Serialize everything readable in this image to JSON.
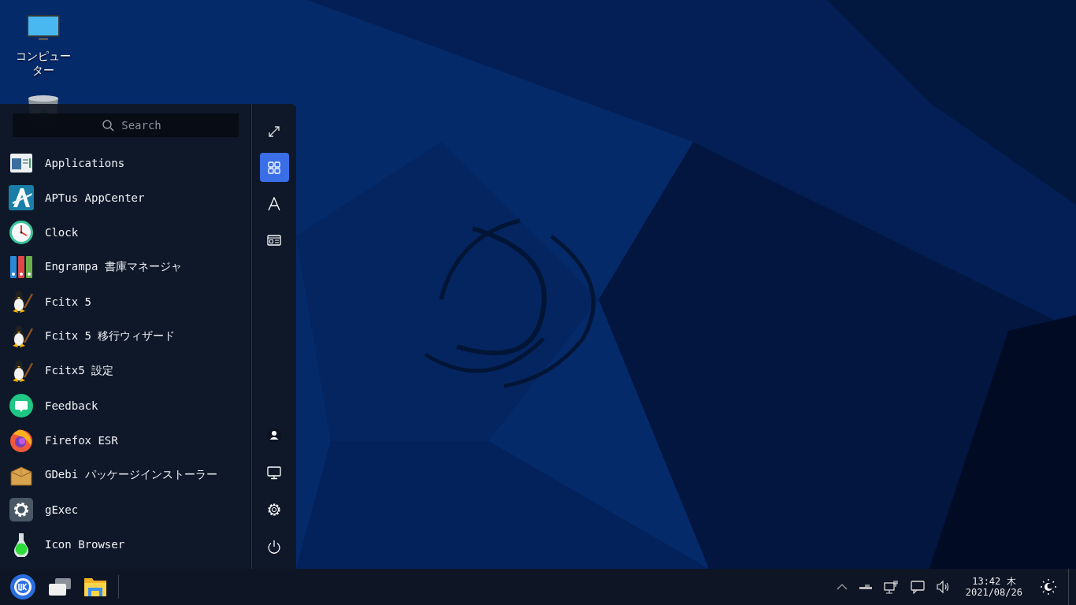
{
  "desktop_icons": [
    {
      "kind": "computer",
      "label": "コンピューター"
    },
    {
      "kind": "trash"
    }
  ],
  "start_menu": {
    "search": {
      "placeholder": "Search"
    },
    "apps": [
      {
        "name": "Applications"
      },
      {
        "name": "APTus AppCenter"
      },
      {
        "name": "Clock"
      },
      {
        "name": "Engrampa 書庫マネージャ"
      },
      {
        "name": "Fcitx 5"
      },
      {
        "name": "Fcitx 5 移行ウィザード"
      },
      {
        "name": "Fcitx5 設定"
      },
      {
        "name": "Feedback"
      },
      {
        "name": "Firefox ESR"
      },
      {
        "name": "GDebi パッケージインストーラー"
      },
      {
        "name": "gExec"
      },
      {
        "name": "Icon Browser"
      }
    ],
    "view_modes": [
      {
        "kind": "all",
        "selected": true
      },
      {
        "kind": "letter",
        "selected": false
      },
      {
        "kind": "category",
        "selected": false
      }
    ]
  },
  "taskbar": {
    "time": "13:42 木",
    "date": "2021/08/26"
  }
}
